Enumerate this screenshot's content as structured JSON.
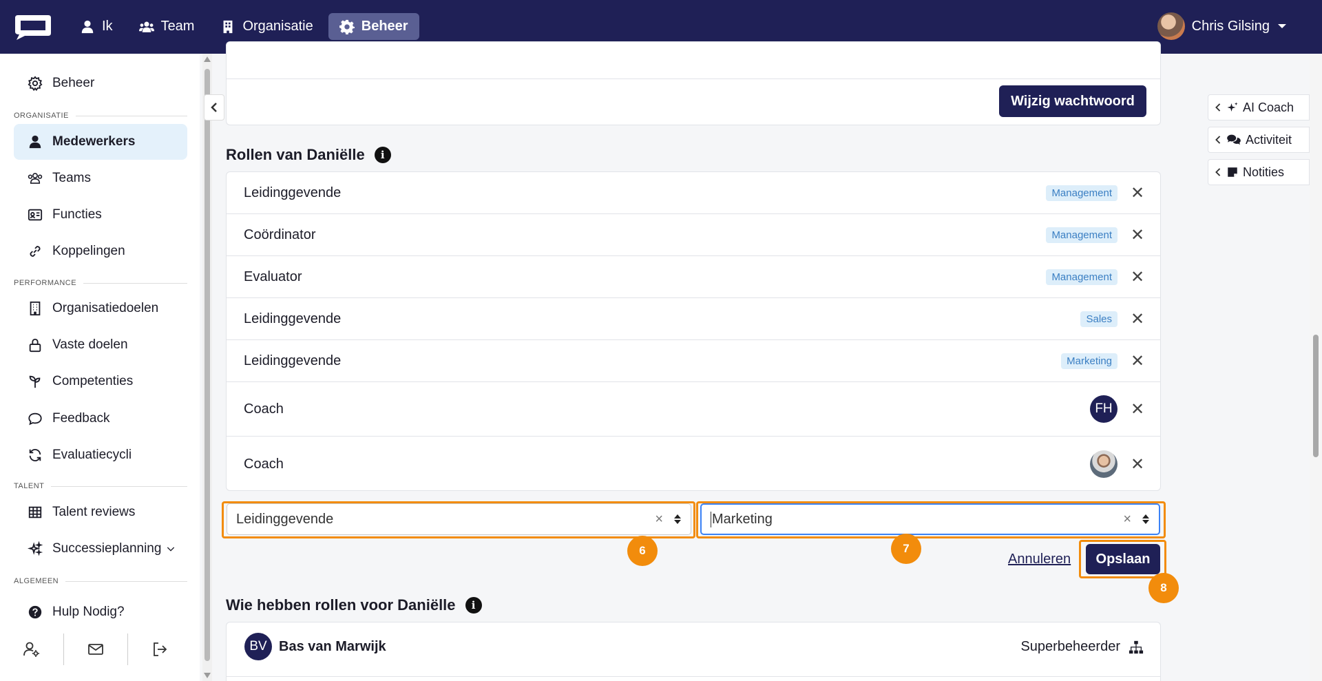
{
  "topnav": {
    "items": [
      {
        "label": "Ik",
        "icon": "user-icon"
      },
      {
        "label": "Team",
        "icon": "users-icon"
      },
      {
        "label": "Organisatie",
        "icon": "building-icon"
      },
      {
        "label": "Beheer",
        "icon": "gear-icon",
        "active": true
      }
    ],
    "user_name": "Chris Gilsing"
  },
  "sidebar": {
    "top_item": "Beheer",
    "sections": {
      "organisatie": "ORGANISATIE",
      "performance": "PERFORMANCE",
      "talent": "TALENT",
      "algemeen": "ALGEMEEN"
    },
    "items": {
      "medewerkers": "Medewerkers",
      "teams": "Teams",
      "functies": "Functies",
      "koppelingen": "Koppelingen",
      "organisatiedoelen": "Organisatiedoelen",
      "vaste_doelen": "Vaste doelen",
      "competenties": "Competenties",
      "feedback": "Feedback",
      "evaluatiecycli": "Evaluatiecycli",
      "talent_reviews": "Talent reviews",
      "successieplanning": "Successieplanning",
      "hulp": "Hulp Nodig?"
    }
  },
  "main": {
    "change_password_button": "Wijzig wachtwoord",
    "roles_title": "Rollen van Daniëlle",
    "roles": [
      {
        "name": "Leidinggevende",
        "badge": "Management"
      },
      {
        "name": "Coördinator",
        "badge": "Management"
      },
      {
        "name": "Evaluator",
        "badge": "Management"
      },
      {
        "name": "Leidinggevende",
        "badge": "Sales"
      },
      {
        "name": "Leidinggevende",
        "badge": "Marketing"
      },
      {
        "name": "Coach",
        "avatar_initials": "FH"
      },
      {
        "name": "Coach",
        "avatar": "photo"
      }
    ],
    "remove_symbol": "✕",
    "role_select_value": "Leidinggevende",
    "scope_select_value": "Marketing",
    "clear_symbol": "×",
    "cancel_link": "Annuleren",
    "save_button": "Opslaan",
    "steps": [
      "6",
      "7",
      "8"
    ],
    "who_title": "Wie hebben rollen voor Daniëlle",
    "who": [
      {
        "initials": "BV",
        "name": "Bas van Marwijk",
        "role": "Superbeheerder"
      }
    ]
  },
  "right_tabs": [
    "AI Coach",
    "Activiteit",
    "Notities"
  ],
  "colors": {
    "navy": "#1f2056",
    "highlight": "#f28c0c",
    "badge_bg": "#ddeefa",
    "badge_text": "#3b7fc3"
  }
}
